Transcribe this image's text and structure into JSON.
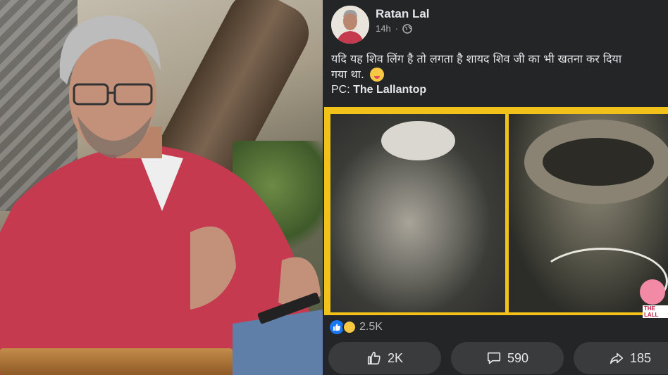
{
  "post": {
    "author": "Ratan Lal",
    "time": "14h",
    "separator": "·",
    "text_line1": "यदि यह शिव लिंग है तो लगता है शायद शिव जी का भी खतना कर दिया",
    "text_line2": "गया था.",
    "credit_prefix": "PC: ",
    "credit_source": "The Lallantop",
    "image_watermark": "THE LALL",
    "reactions_count": "2.5K",
    "actions": {
      "like": "2K",
      "comment": "590",
      "share": "185"
    }
  },
  "icons": {
    "privacy": "globe-icon",
    "like": "thumbs-up-icon",
    "comment": "comment-icon",
    "share": "share-icon",
    "emoji": "winking-tongue-emoji-icon"
  },
  "colors": {
    "post_bg": "#242526",
    "text": "#e4e6eb",
    "secondary_text": "#b0b3b8",
    "media_border": "#f2c21a",
    "like_blue": "#1877f2"
  }
}
